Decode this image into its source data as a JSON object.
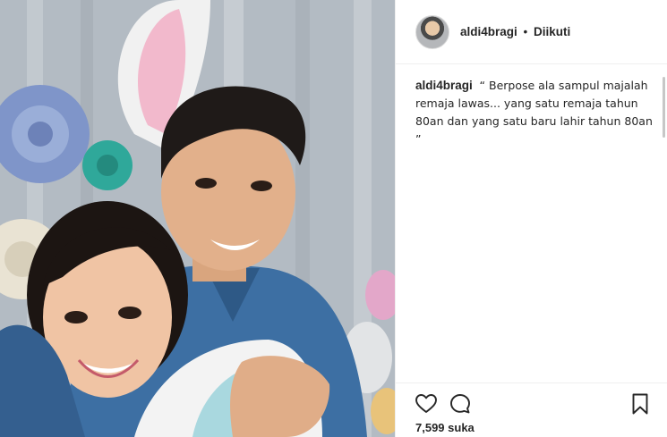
{
  "post": {
    "username": "aldi4bragi",
    "separator": "•",
    "follow_status": "Diikuti",
    "caption": "“ Berpose ala sampul majalah remaja lawas... yang satu remaja tahun 80an dan yang satu baru lahir tahun 80an ”",
    "likes": "7,599 suka"
  },
  "icons": {
    "like": "heart-icon",
    "comment": "comment-bubble-icon",
    "save": "bookmark-icon"
  },
  "colors": {
    "text": "#262626",
    "divider": "#efefef"
  }
}
